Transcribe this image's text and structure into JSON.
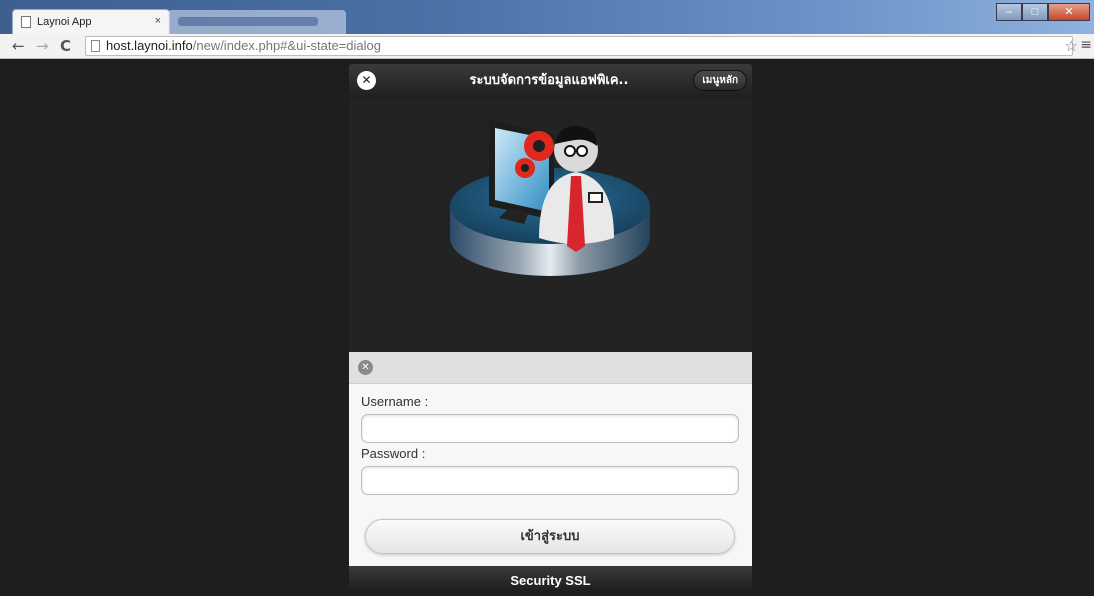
{
  "browser": {
    "tab_title": "Laynoi App",
    "tab_close": "×",
    "url_host": "host.laynoi.info",
    "url_path": "/new/index.php#&ui-state=dialog"
  },
  "dialog": {
    "title": "ระบบจัดการข้อมูลแอฟพิเค..",
    "menu_label": "เมนูหลัก"
  },
  "login": {
    "username_label": "Username :",
    "password_label": "Password :",
    "username_value": "",
    "password_value": "",
    "submit_label": "เข้าสู่ระบบ"
  },
  "footer": {
    "text": "Security SSL"
  },
  "colors": {
    "header": "#2a2a2a",
    "platform": "#1f5a82",
    "gear": "#e0281e",
    "tie": "#d8262d"
  }
}
